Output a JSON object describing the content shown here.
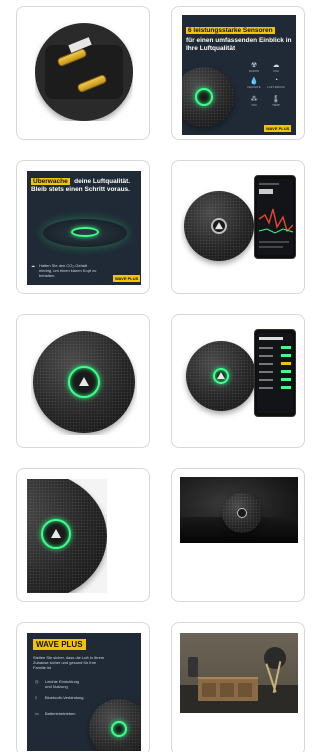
{
  "tiles": [
    {
      "id": "device-underside",
      "kind": "photo"
    },
    {
      "id": "sensors-card",
      "kind": "infographic",
      "headline_highlight": "6 leistungsstarke Sensoren",
      "headline_rest": "für einen umfassenden Einblick in Ihre Luftqualität",
      "sensors": [
        {
          "icon": "radon-icon",
          "label": "RADON"
        },
        {
          "icon": "co2-icon",
          "label": "CO2"
        },
        {
          "icon": "humidity-icon",
          "label": "FEUCHTE"
        },
        {
          "icon": "pressure-icon",
          "label": "LUFT-DRUCK"
        },
        {
          "icon": "voc-icon",
          "label": "VOC"
        },
        {
          "icon": "temperature-icon",
          "label": "TEMP"
        }
      ],
      "brand": "WAVE PLUS"
    },
    {
      "id": "monitor-card",
      "kind": "infographic",
      "headline_highlight": "Überwache",
      "headline_rest_1": "deine Luftqualität.",
      "headline_rest_2": "Bleib stets einen Schritt voraus.",
      "body": "Halten Sie den CO₂-Gehalt niedrig, um einen klaren Kopf zu behalten.",
      "brand": "WAVE PLUS"
    },
    {
      "id": "device-with-app-graph",
      "kind": "photo"
    },
    {
      "id": "device-front-glow",
      "kind": "photo"
    },
    {
      "id": "device-with-app-list",
      "kind": "photo"
    },
    {
      "id": "device-closeup",
      "kind": "photo"
    },
    {
      "id": "device-on-fabric",
      "kind": "photo"
    },
    {
      "id": "family-card",
      "kind": "infographic",
      "brand": "WAVE PLUS",
      "body": "Stellen Sie sicher, dass die Luft in Ihrem Zuhause sicher und gesund für Ihre Familie ist",
      "features": [
        {
          "icon": "clock-icon",
          "label": "Leichte Einrichtung und Nutzung"
        },
        {
          "icon": "bluetooth-icon",
          "label": "Bluetooth-Verbindung"
        },
        {
          "icon": "battery-icon",
          "label": "Batteriebetrieben"
        }
      ]
    },
    {
      "id": "living-room",
      "kind": "photo"
    }
  ],
  "colors": {
    "accent_yellow": "#f5c400",
    "ring_green": "#3dff8a",
    "card_dark": "#1f2a36",
    "tile_border": "#d8d8d8"
  }
}
